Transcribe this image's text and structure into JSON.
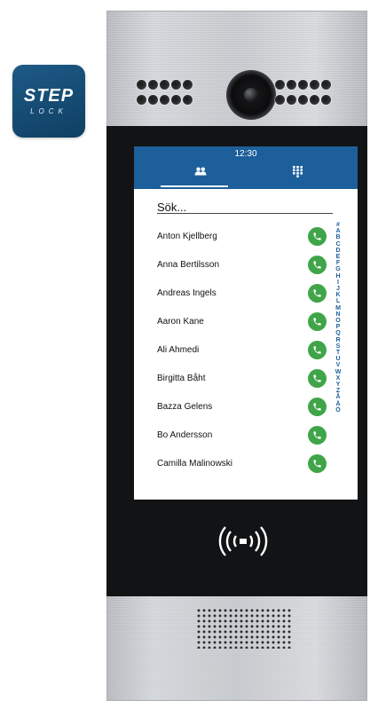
{
  "logo": {
    "brand": "STEP",
    "sub": "LOCK"
  },
  "status": {
    "time": "12:30"
  },
  "tabs": [
    {
      "name": "contacts",
      "icon": "contacts-icon",
      "glyph": "👥"
    },
    {
      "name": "dialpad",
      "icon": "dialpad-icon",
      "glyph": "⠿"
    }
  ],
  "search": {
    "placeholder": "Sök..."
  },
  "contacts": [
    {
      "name": "Anton Kjellberg"
    },
    {
      "name": "Anna Bertilsson"
    },
    {
      "name": "Andreas Ingels"
    },
    {
      "name": "Aaron Kane"
    },
    {
      "name": "Ali Ahmedi"
    },
    {
      "name": "Birgitta Båht"
    },
    {
      "name": "Bazza Gelens"
    },
    {
      "name": "Bo Andersson"
    },
    {
      "name": "Camilla Malinowski"
    }
  ],
  "alphabet": [
    "#",
    "A",
    "B",
    "C",
    "D",
    "E",
    "F",
    "G",
    "H",
    "I",
    "J",
    "K",
    "L",
    "M",
    "N",
    "O",
    "P",
    "Q",
    "R",
    "S",
    "T",
    "U",
    "V",
    "W",
    "X",
    "Y",
    "Z",
    "Å",
    "Ä",
    "Ö"
  ],
  "colors": {
    "accent": "#1d5f9b",
    "call": "#3fa548",
    "brand": "#1d5a86"
  }
}
